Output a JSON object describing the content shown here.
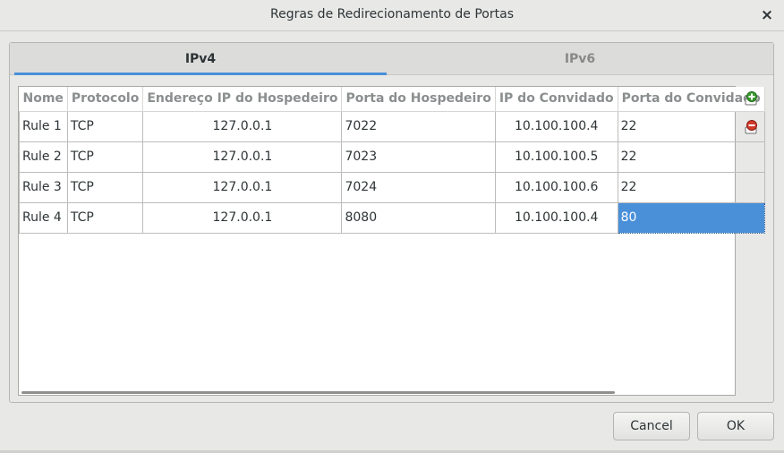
{
  "window": {
    "title": "Regras de Redirecionamento de Portas",
    "close_label": "×"
  },
  "tabs": [
    {
      "label": "IPv4",
      "active": true
    },
    {
      "label": "IPv6",
      "active": false
    }
  ],
  "table": {
    "headers": [
      "Nome",
      "Protocolo",
      "Endereço IP do Hospedeiro",
      "Porta do Hospedeiro",
      "IP do Convidado",
      "Porta do Convidado"
    ],
    "rows": [
      {
        "name": "Rule 1",
        "protocol": "TCP",
        "host_ip": "127.0.0.1",
        "host_port": "7022",
        "guest_ip": "10.100.100.4",
        "guest_port": "22"
      },
      {
        "name": "Rule 2",
        "protocol": "TCP",
        "host_ip": "127.0.0.1",
        "host_port": "7023",
        "guest_ip": "10.100.100.5",
        "guest_port": "22"
      },
      {
        "name": "Rule 3",
        "protocol": "TCP",
        "host_ip": "127.0.0.1",
        "host_port": "7024",
        "guest_ip": "10.100.100.6",
        "guest_port": "22"
      },
      {
        "name": "Rule 4",
        "protocol": "TCP",
        "host_ip": "127.0.0.1",
        "host_port": "8080",
        "guest_ip": "10.100.100.4",
        "guest_port": "80"
      }
    ],
    "selected_cell": {
      "row": 4,
      "column": "Porta do Convidado"
    }
  },
  "side_actions": [
    {
      "icon": "add-rule-icon"
    },
    {
      "icon": "remove-rule-icon"
    }
  ],
  "buttons": {
    "cancel_label": "Cancel",
    "ok_label": "OK"
  },
  "colors": {
    "accent": "#4a90d9",
    "add_icon": "#3a9a2e",
    "remove_icon": "#d23a2a"
  }
}
